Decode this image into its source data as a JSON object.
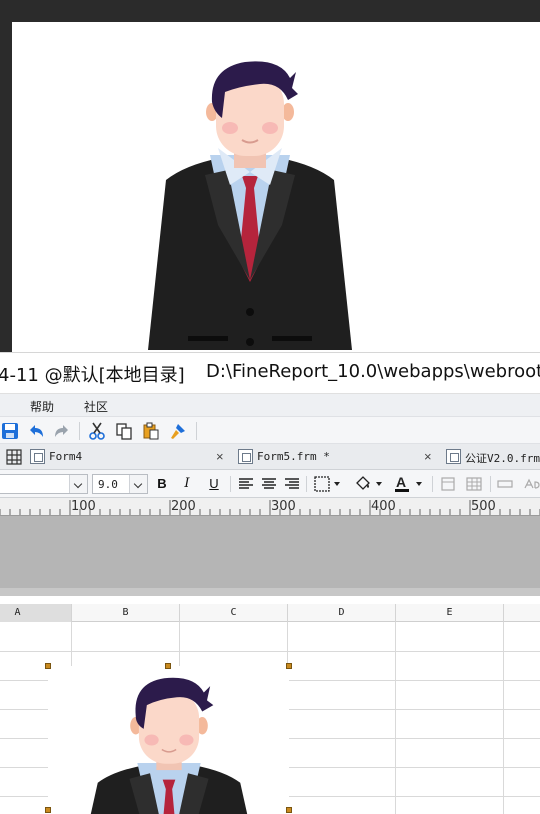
{
  "window": {
    "title_part1": "4-11 @默认[本地目录]",
    "title_part2": "D:\\FineReport_10.0\\webapps\\webroot\\"
  },
  "menu": {
    "items": [
      {
        "label": "",
        "partial": true
      },
      {
        "label": "帮助"
      },
      {
        "label": "社区"
      }
    ]
  },
  "toolbar": {
    "icons": [
      "save-icon",
      "undo-icon",
      "redo-icon",
      "cut-icon",
      "copy-icon",
      "paste-icon",
      "format-painter-icon"
    ]
  },
  "tabs": [
    {
      "label": "Form4",
      "close": "×"
    },
    {
      "label": "Form5.frm *",
      "close": "×"
    },
    {
      "label": "公证V2.0.frm",
      "close": ""
    }
  ],
  "format": {
    "font_size": "9.0",
    "bold": "B",
    "italic": "I",
    "underline": "U"
  },
  "ruler": {
    "labels": [
      "100",
      "200",
      "300",
      "400",
      "500"
    ]
  },
  "sheet": {
    "columns": [
      "A",
      "B",
      "C",
      "D",
      "E"
    ]
  },
  "colors": {
    "accent": "#1e6fd9",
    "handle": "#c98a1f",
    "hair": "#2c1b4b",
    "tie": "#b5243c",
    "suit": "#1f1f1f",
    "shirt": "#b9d2ee",
    "skin": "#fbd8c9"
  }
}
